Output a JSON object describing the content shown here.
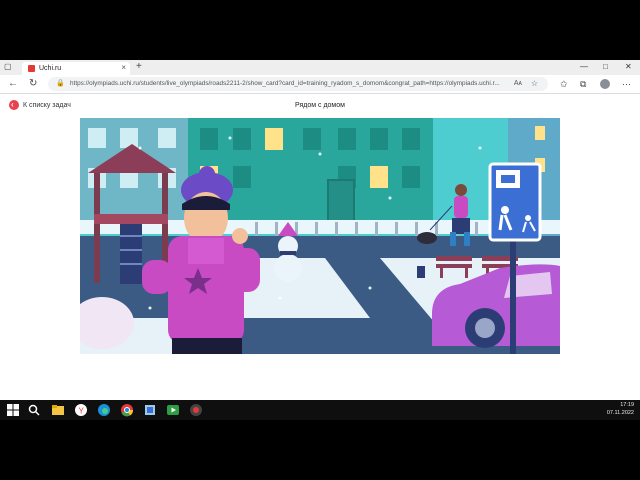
{
  "browser": {
    "tab_title": "Uchi.ru",
    "new_tab_symbol": "+",
    "tab_close_symbol": "×",
    "url": "https://olympiads.uchi.ru/students/live_olympiads/roads2211-2/show_card?card_id=training_ryadom_s_domom&congrat_path=https://olympiads.uchi.r...",
    "icons": {
      "back": "back-arrow-icon",
      "refresh": "refresh-icon",
      "lock": "lock-icon",
      "read_aloud": "read-aloud-icon",
      "favorite": "star-icon",
      "favorites": "favorites-icon",
      "collections": "collections-icon",
      "more": "more-icon"
    },
    "read_aloud_label": "Aᴀ",
    "window_controls": [
      "—",
      "□",
      "✕"
    ]
  },
  "page": {
    "back_link": "К списку задач",
    "title": "Рядом с домом",
    "accent_color": "#e8424c"
  },
  "scene": {
    "sign_color": "#3b6fd4",
    "sky_color": "#4ecdd0",
    "building_color": "#2aa79c",
    "car_color": "#b65ad6",
    "jacket_color": "#c84bc4"
  },
  "taskbar": {
    "time": "17:19",
    "date": "07.11.2022"
  }
}
